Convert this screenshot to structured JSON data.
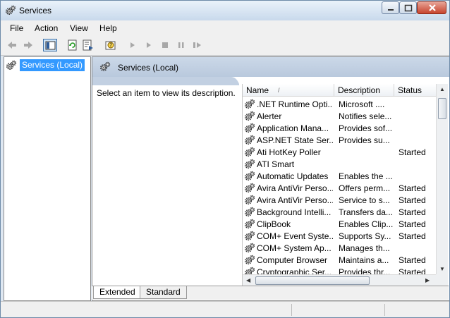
{
  "window": {
    "title": "Services"
  },
  "menu": [
    "File",
    "Action",
    "View",
    "Help"
  ],
  "toolbar": {
    "buttons": [
      "back-icon",
      "forward-icon",
      "show-hide-console-tree-icon",
      "refresh-icon",
      "export-list-icon",
      "properties-help-icon",
      "start-service-icon",
      "start-service-alt-icon",
      "stop-service-icon",
      "pause-service-icon",
      "restart-service-icon"
    ]
  },
  "tree": {
    "selected_label": "Services (Local)"
  },
  "pane": {
    "header_title": "Services (Local)",
    "description_prompt": "Select an item to view its description."
  },
  "list": {
    "columns": [
      "Name",
      "Description",
      "Status"
    ],
    "sort_indicator": "/",
    "rows": [
      {
        "name": ".NET Runtime Opti...",
        "description": "Microsoft ....",
        "status": ""
      },
      {
        "name": "Alerter",
        "description": "Notifies sele...",
        "status": ""
      },
      {
        "name": "Application Mana...",
        "description": "Provides sof...",
        "status": ""
      },
      {
        "name": "ASP.NET State Ser...",
        "description": "Provides su...",
        "status": ""
      },
      {
        "name": "Ati HotKey Poller",
        "description": "",
        "status": "Started"
      },
      {
        "name": "ATI Smart",
        "description": "",
        "status": ""
      },
      {
        "name": "Automatic Updates",
        "description": "Enables the ...",
        "status": ""
      },
      {
        "name": "Avira AntiVir Perso...",
        "description": "Offers perm...",
        "status": "Started"
      },
      {
        "name": "Avira AntiVir Perso...",
        "description": "Service to s...",
        "status": "Started"
      },
      {
        "name": "Background Intelli...",
        "description": "Transfers da...",
        "status": "Started"
      },
      {
        "name": "ClipBook",
        "description": "Enables Clip...",
        "status": "Started"
      },
      {
        "name": "COM+ Event Syste...",
        "description": "Supports Sy...",
        "status": "Started"
      },
      {
        "name": "COM+ System Ap...",
        "description": "Manages th...",
        "status": ""
      },
      {
        "name": "Computer Browser",
        "description": "Maintains a...",
        "status": "Started"
      },
      {
        "name": "Cryptographic Ser...",
        "description": "Provides thr...",
        "status": "Started"
      }
    ]
  },
  "tabs": [
    {
      "label": "Extended",
      "active": true
    },
    {
      "label": "Standard",
      "active": false
    }
  ],
  "colors": {
    "selection": "#3399ff",
    "header_band": "#c1cfe1",
    "close_button": "#c7442e"
  }
}
